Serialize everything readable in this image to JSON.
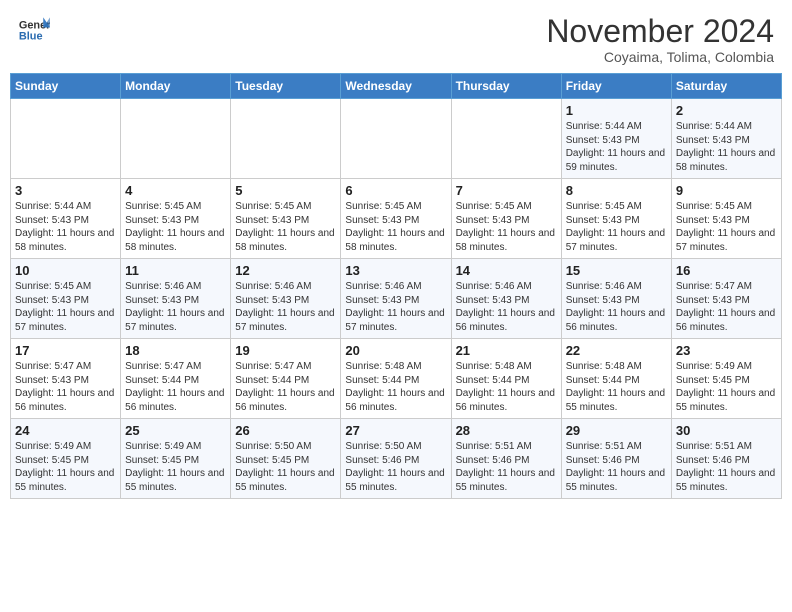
{
  "header": {
    "logo_line1": "General",
    "logo_line2": "Blue",
    "month": "November 2024",
    "location": "Coyaima, Tolima, Colombia"
  },
  "weekdays": [
    "Sunday",
    "Monday",
    "Tuesday",
    "Wednesday",
    "Thursday",
    "Friday",
    "Saturday"
  ],
  "weeks": [
    [
      {
        "day": "",
        "info": ""
      },
      {
        "day": "",
        "info": ""
      },
      {
        "day": "",
        "info": ""
      },
      {
        "day": "",
        "info": ""
      },
      {
        "day": "",
        "info": ""
      },
      {
        "day": "1",
        "info": "Sunrise: 5:44 AM\nSunset: 5:43 PM\nDaylight: 11 hours and 59 minutes."
      },
      {
        "day": "2",
        "info": "Sunrise: 5:44 AM\nSunset: 5:43 PM\nDaylight: 11 hours and 58 minutes."
      }
    ],
    [
      {
        "day": "3",
        "info": "Sunrise: 5:44 AM\nSunset: 5:43 PM\nDaylight: 11 hours and 58 minutes."
      },
      {
        "day": "4",
        "info": "Sunrise: 5:45 AM\nSunset: 5:43 PM\nDaylight: 11 hours and 58 minutes."
      },
      {
        "day": "5",
        "info": "Sunrise: 5:45 AM\nSunset: 5:43 PM\nDaylight: 11 hours and 58 minutes."
      },
      {
        "day": "6",
        "info": "Sunrise: 5:45 AM\nSunset: 5:43 PM\nDaylight: 11 hours and 58 minutes."
      },
      {
        "day": "7",
        "info": "Sunrise: 5:45 AM\nSunset: 5:43 PM\nDaylight: 11 hours and 58 minutes."
      },
      {
        "day": "8",
        "info": "Sunrise: 5:45 AM\nSunset: 5:43 PM\nDaylight: 11 hours and 57 minutes."
      },
      {
        "day": "9",
        "info": "Sunrise: 5:45 AM\nSunset: 5:43 PM\nDaylight: 11 hours and 57 minutes."
      }
    ],
    [
      {
        "day": "10",
        "info": "Sunrise: 5:45 AM\nSunset: 5:43 PM\nDaylight: 11 hours and 57 minutes."
      },
      {
        "day": "11",
        "info": "Sunrise: 5:46 AM\nSunset: 5:43 PM\nDaylight: 11 hours and 57 minutes."
      },
      {
        "day": "12",
        "info": "Sunrise: 5:46 AM\nSunset: 5:43 PM\nDaylight: 11 hours and 57 minutes."
      },
      {
        "day": "13",
        "info": "Sunrise: 5:46 AM\nSunset: 5:43 PM\nDaylight: 11 hours and 57 minutes."
      },
      {
        "day": "14",
        "info": "Sunrise: 5:46 AM\nSunset: 5:43 PM\nDaylight: 11 hours and 56 minutes."
      },
      {
        "day": "15",
        "info": "Sunrise: 5:46 AM\nSunset: 5:43 PM\nDaylight: 11 hours and 56 minutes."
      },
      {
        "day": "16",
        "info": "Sunrise: 5:47 AM\nSunset: 5:43 PM\nDaylight: 11 hours and 56 minutes."
      }
    ],
    [
      {
        "day": "17",
        "info": "Sunrise: 5:47 AM\nSunset: 5:43 PM\nDaylight: 11 hours and 56 minutes."
      },
      {
        "day": "18",
        "info": "Sunrise: 5:47 AM\nSunset: 5:44 PM\nDaylight: 11 hours and 56 minutes."
      },
      {
        "day": "19",
        "info": "Sunrise: 5:47 AM\nSunset: 5:44 PM\nDaylight: 11 hours and 56 minutes."
      },
      {
        "day": "20",
        "info": "Sunrise: 5:48 AM\nSunset: 5:44 PM\nDaylight: 11 hours and 56 minutes."
      },
      {
        "day": "21",
        "info": "Sunrise: 5:48 AM\nSunset: 5:44 PM\nDaylight: 11 hours and 56 minutes."
      },
      {
        "day": "22",
        "info": "Sunrise: 5:48 AM\nSunset: 5:44 PM\nDaylight: 11 hours and 55 minutes."
      },
      {
        "day": "23",
        "info": "Sunrise: 5:49 AM\nSunset: 5:45 PM\nDaylight: 11 hours and 55 minutes."
      }
    ],
    [
      {
        "day": "24",
        "info": "Sunrise: 5:49 AM\nSunset: 5:45 PM\nDaylight: 11 hours and 55 minutes."
      },
      {
        "day": "25",
        "info": "Sunrise: 5:49 AM\nSunset: 5:45 PM\nDaylight: 11 hours and 55 minutes."
      },
      {
        "day": "26",
        "info": "Sunrise: 5:50 AM\nSunset: 5:45 PM\nDaylight: 11 hours and 55 minutes."
      },
      {
        "day": "27",
        "info": "Sunrise: 5:50 AM\nSunset: 5:46 PM\nDaylight: 11 hours and 55 minutes."
      },
      {
        "day": "28",
        "info": "Sunrise: 5:51 AM\nSunset: 5:46 PM\nDaylight: 11 hours and 55 minutes."
      },
      {
        "day": "29",
        "info": "Sunrise: 5:51 AM\nSunset: 5:46 PM\nDaylight: 11 hours and 55 minutes."
      },
      {
        "day": "30",
        "info": "Sunrise: 5:51 AM\nSunset: 5:46 PM\nDaylight: 11 hours and 55 minutes."
      }
    ]
  ]
}
